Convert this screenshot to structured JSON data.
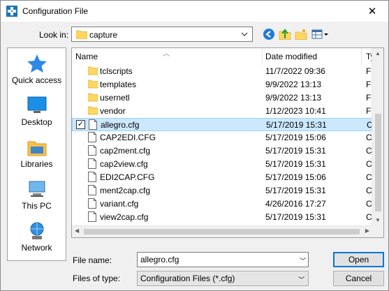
{
  "window": {
    "title": "Configuration File"
  },
  "lookin": {
    "label": "Look in:",
    "value": "capture"
  },
  "places": [
    {
      "label": "Quick access",
      "icon": "quick-access-icon"
    },
    {
      "label": "Desktop",
      "icon": "desktop-icon"
    },
    {
      "label": "Libraries",
      "icon": "libraries-icon"
    },
    {
      "label": "This PC",
      "icon": "this-pc-icon"
    },
    {
      "label": "Network",
      "icon": "network-icon"
    }
  ],
  "columns": {
    "name": "Name",
    "date": "Date modified",
    "type": "Ty"
  },
  "files": [
    {
      "name": "tclscripts",
      "date": "11/7/2022 09:36",
      "type": "Fil",
      "kind": "folder",
      "selected": false
    },
    {
      "name": "templates",
      "date": "9/9/2022 13:13",
      "type": "Fil",
      "kind": "folder",
      "selected": false
    },
    {
      "name": "usernetl",
      "date": "9/9/2022 13:13",
      "type": "Fil",
      "kind": "folder",
      "selected": false
    },
    {
      "name": "vendor",
      "date": "1/12/2023 10:41",
      "type": "Fil",
      "kind": "folder",
      "selected": false
    },
    {
      "name": "allegro.cfg",
      "date": "5/17/2019 15:31",
      "type": "CF",
      "kind": "file",
      "selected": true
    },
    {
      "name": "CAP2EDI.CFG",
      "date": "5/17/2019 15:06",
      "type": "CF",
      "kind": "file",
      "selected": false
    },
    {
      "name": "cap2ment.cfg",
      "date": "5/17/2019 15:31",
      "type": "CF",
      "kind": "file",
      "selected": false
    },
    {
      "name": "cap2view.cfg",
      "date": "5/17/2019 15:31",
      "type": "CF",
      "kind": "file",
      "selected": false
    },
    {
      "name": "EDI2CAP.CFG",
      "date": "5/17/2019 15:06",
      "type": "CF",
      "kind": "file",
      "selected": false
    },
    {
      "name": "ment2cap.cfg",
      "date": "5/17/2019 15:31",
      "type": "CF",
      "kind": "file",
      "selected": false
    },
    {
      "name": "variant.cfg",
      "date": "4/26/2016 17:27",
      "type": "CF",
      "kind": "file",
      "selected": false
    },
    {
      "name": "view2cap.cfg",
      "date": "5/17/2019 15:31",
      "type": "CF",
      "kind": "file",
      "selected": false
    }
  ],
  "filename": {
    "label": "File name:",
    "value": "allegro.cfg"
  },
  "filetype": {
    "label": "Files of type:",
    "value": "Configuration Files (*.cfg)"
  },
  "buttons": {
    "open": "Open",
    "cancel": "Cancel"
  },
  "colors": {
    "selection": "#cce8ff",
    "accent": "#0078d7",
    "folder": "#ffd75e"
  }
}
